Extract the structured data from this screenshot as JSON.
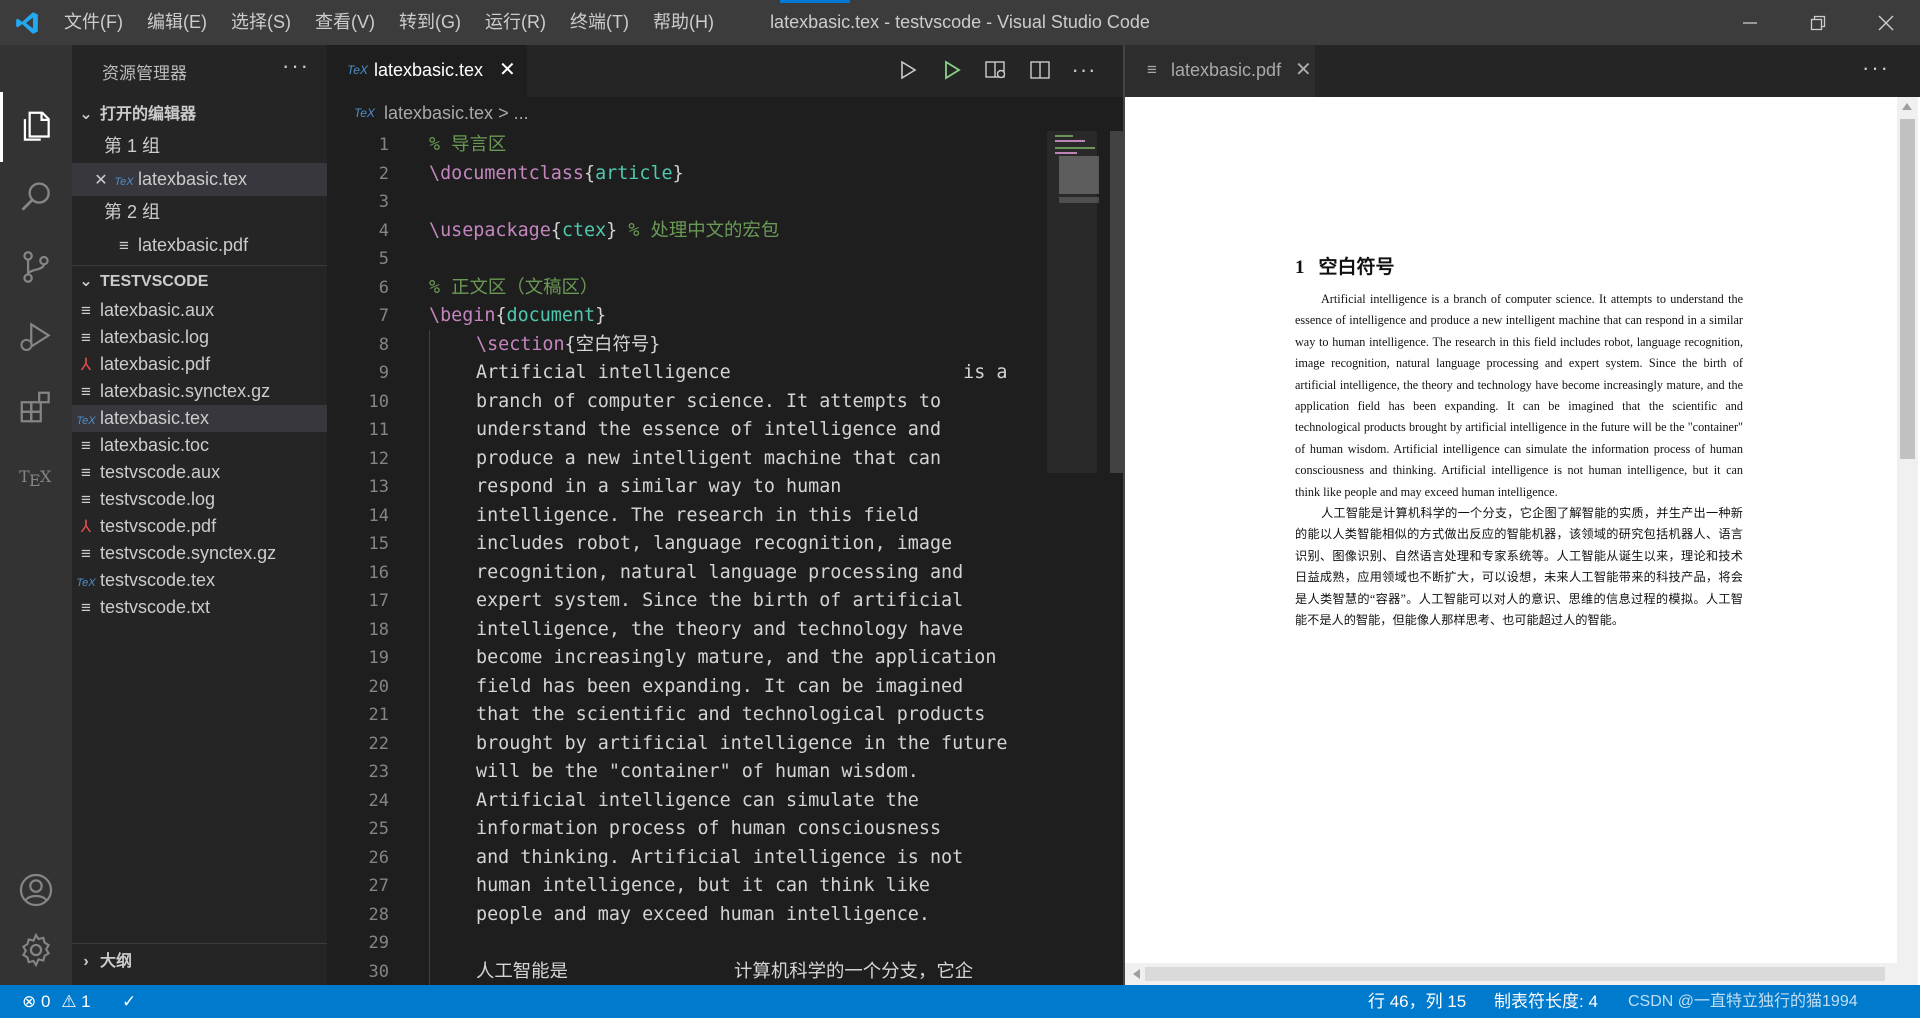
{
  "window": {
    "title": "latexbasic.tex - testvscode - Visual Studio Code",
    "menu": [
      "文件(F)",
      "编辑(E)",
      "选择(S)",
      "查看(V)",
      "转到(G)",
      "运行(R)",
      "终端(T)",
      "帮助(H)"
    ]
  },
  "activity_bar": {
    "items": [
      "files-icon",
      "search-icon",
      "source-control-icon",
      "run-debug-icon",
      "extensions-icon",
      "tex-icon"
    ],
    "bottom": [
      "account-icon",
      "gear-icon"
    ]
  },
  "sidebar": {
    "title": "资源管理器",
    "more": "···",
    "open_editors": {
      "header": "打开的编辑器",
      "groups": [
        {
          "label": "第 1 组",
          "files": [
            {
              "name": "latexbasic.tex",
              "icon": "TeX"
            }
          ]
        },
        {
          "label": "第 2 组",
          "files": [
            {
              "name": "latexbasic.pdf",
              "icon": "≡"
            }
          ]
        }
      ]
    },
    "workspace": {
      "header": "TESTVSCODE",
      "files": [
        {
          "name": "latexbasic.aux",
          "type": "file"
        },
        {
          "name": "latexbasic.log",
          "type": "file"
        },
        {
          "name": "latexbasic.pdf",
          "type": "pdf"
        },
        {
          "name": "latexbasic.synctex.gz",
          "type": "file"
        },
        {
          "name": "latexbasic.tex",
          "type": "tex"
        },
        {
          "name": "latexbasic.toc",
          "type": "file"
        },
        {
          "name": "testvscode.aux",
          "type": "file"
        },
        {
          "name": "testvscode.log",
          "type": "file"
        },
        {
          "name": "testvscode.pdf",
          "type": "pdf"
        },
        {
          "name": "testvscode.synctex.gz",
          "type": "file"
        },
        {
          "name": "testvscode.tex",
          "type": "tex"
        },
        {
          "name": "testvscode.txt",
          "type": "file"
        }
      ]
    },
    "outline": {
      "header": "大纲"
    }
  },
  "editor1": {
    "tab": {
      "label": "latexbasic.tex",
      "icon": "TeX",
      "close": "✕"
    },
    "breadcrumb": {
      "file": "latexbasic.tex",
      "rest": "> ..."
    },
    "line_numbers": [
      "1",
      "2",
      "3",
      "4",
      "5",
      "6",
      "7",
      "8",
      "9",
      "10",
      "11",
      "12",
      "13",
      "14",
      "15",
      "16",
      "17",
      "18",
      "19",
      "20",
      "21",
      "22",
      "23",
      "24",
      "25",
      "26",
      "27",
      "28",
      "29",
      "30"
    ],
    "lines": {
      "l1": "% 导言区",
      "l2_cmd": "\\documentclass",
      "l2_arg": "article",
      "l4_cmd": "\\usepackage",
      "l4_arg": "ctex",
      "l4_cm": "% 处理中文的宏包",
      "l6": "% 正文区（文稿区）",
      "l7_cmd": "\\begin",
      "l7_arg": "document",
      "l8_cmd": "\\section",
      "l8_arg": "空白符号",
      "l9": "Artificial intelligence                     is a",
      "l10": "branch of computer science. It attempts to",
      "l11": "understand the essence of intelligence and",
      "l12": "produce a new intelligent machine that can",
      "l13": "respond in a similar way to human",
      "l14": "intelligence. The research in this field",
      "l15": "includes robot, language recognition, image",
      "l16": "recognition, natural language processing and",
      "l17": "expert system. Since the birth of artificial",
      "l18": "intelligence, the theory and technology have",
      "l19": "become increasingly mature, and the application",
      "l20": "field has been expanding. It can be imagined",
      "l21": "that the scientific and technological products",
      "l22": "brought by artificial intelligence in the future",
      "l23": "will be the \"container\" of human wisdom.",
      "l24": "Artificial intelligence can simulate the",
      "l25": "information process of human consciousness",
      "l26": "and thinking. Artificial intelligence is not",
      "l27": "human intelligence, but it can think like",
      "l28": "people and may exceed human intelligence.",
      "l30": "人工智能是               计算机科学的一个分支，它企"
    }
  },
  "editor2": {
    "tab": {
      "label": "latexbasic.pdf",
      "icon": "≡",
      "close": "✕"
    },
    "more": "···",
    "pdf": {
      "section_number": "1",
      "section_title": "空白符号",
      "para_en": "Artificial intelligence is a branch of computer science. It attempts to understand the essence of intelligence and produce a new intelligent machine that can respond in a similar way to human intelligence. The research in this field includes robot, language recognition, image recognition, natural language processing and expert system. Since the birth of artificial intelligence, the theory and technology have become increasingly mature, and the application field has been expanding. It can be imagined that the scientific and technological products brought by artificial intelligence in the future will be the \"container\" of human wisdom. Artificial intelligence can simulate the information process of human consciousness and thinking. Artificial intelligence is not human intelligence, but it can think like people and may exceed human intelligence.",
      "para_zh": "人工智能是计算机科学的一个分支，它企图了解智能的实质，并生产出一种新的能以人类智能相似的方式做出反应的智能机器，该领域的研究包括机器人、语言识别、图像识别、自然语言处理和专家系统等。人工智能从诞生以来，理论和技术日益成熟，应用领域也不断扩大，可以设想，未来人工智能带来的科技产品，将会是人类智慧的“容器”。人工智能可以对人的意识、思维的信息过程的模拟。人工智能不是人的智能，但能像人那样思考、也可能超过人的智能。"
    }
  },
  "status_bar": {
    "errors": "0",
    "warnings": "1",
    "position": "行 46，列 15",
    "tab_size": "制表符长度: 4",
    "watermark": "CSDN @一直特立独行的猫1994"
  }
}
